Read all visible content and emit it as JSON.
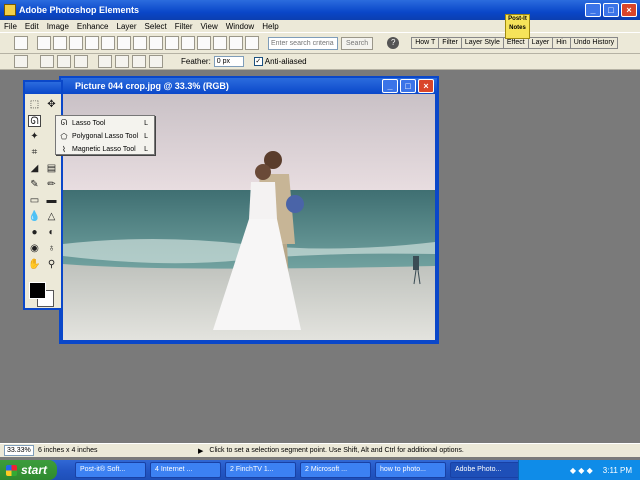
{
  "app": {
    "title": "Adobe Photoshop Elements"
  },
  "menu": [
    "File",
    "Edit",
    "Image",
    "Enhance",
    "Layer",
    "Select",
    "Filter",
    "View",
    "Window",
    "Help"
  ],
  "toolbar": {
    "search_placeholder": "Enter search criteria",
    "search_button": "Search"
  },
  "palette_tabs": [
    "How T",
    "Filter",
    "Layer Style",
    "Effect",
    "Layer",
    "Hin",
    "Undo History"
  ],
  "postit": {
    "line1": "Post-It",
    "line2": "Notes"
  },
  "options": {
    "feather_label": "Feather:",
    "feather_value": "0 px",
    "anti_aliased_label": "Anti-aliased",
    "anti_aliased_checked": true
  },
  "document": {
    "title": "Picture 044 crop.jpg @ 33.3% (RGB)"
  },
  "flyout": [
    {
      "label": "Lasso Tool",
      "key": "L",
      "icon": "lasso-icon"
    },
    {
      "label": "Polygonal Lasso Tool",
      "key": "L",
      "icon": "polygonal-lasso-icon"
    },
    {
      "label": "Magnetic Lasso Tool",
      "key": "L",
      "icon": "magnetic-lasso-icon"
    }
  ],
  "status": {
    "zoom": "33.33%",
    "doc_size": "6 inches x 4 inches",
    "hint": "Click to set a selection segment point.  Use Shift, Alt and Ctrl for additional options."
  },
  "taskbar": {
    "start": "start",
    "tasks": [
      "Post-it® Soft...",
      "4 Internet ...",
      "2 FinchTV 1...",
      "2 Microsoft ...",
      "how to photo...",
      "Adobe Photo..."
    ],
    "clock": "3:11 PM"
  },
  "colors": {
    "title_blue": "#0a47c9",
    "taskbar_blue": "#2457c5",
    "start_green": "#3c9d3c",
    "window_face": "#ece9d8"
  }
}
